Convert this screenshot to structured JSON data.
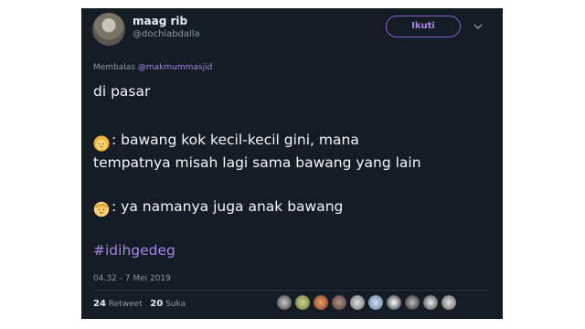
{
  "user": {
    "name": "maag rib",
    "handle": "@dochiabdalla"
  },
  "follow_button": "Ikuti",
  "reply_to": {
    "prefix": "Membalas",
    "mention": "@makmummasjid"
  },
  "tweet": {
    "line1": "di pasar",
    "line2": ": bawang kok kecil-kecil gini, mana",
    "line3": "tempatnya misah lagi sama bawang yang lain",
    "line4": ": ya namanya juga anak bawang",
    "hashtag": "#idihgedeg"
  },
  "emojis": {
    "speaker1": "person-blond-hair-icon",
    "speaker2": "older-man-icon"
  },
  "timestamp": "04.32 - 7 Mei 2019",
  "stats": {
    "retweets": "24",
    "retweet_label": "Retweet",
    "likes": "20",
    "like_label": "Suka"
  },
  "colors": {
    "background": "#141d26",
    "accent": "#a782ea",
    "muted": "#8899a6"
  }
}
